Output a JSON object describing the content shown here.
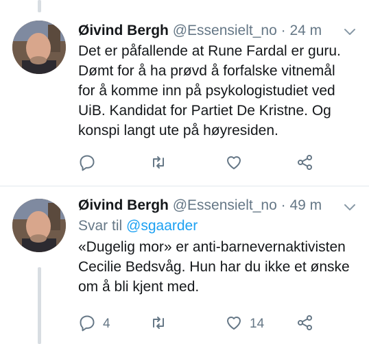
{
  "tweets": [
    {
      "author_name": "Øivind Bergh",
      "handle": "@Essensielt_no",
      "separator": "·",
      "time": "24 m",
      "reply_prefix": "",
      "reply_handle": "",
      "text": "Det er påfallende at Rune Fardal er guru.\nDømt for å ha prøvd å forfalske vitnemål\nfor å komme inn på psykologistudiet ved\nUiB. Kandidat for Partiet De Kristne. Og\nkonspi langt ute på høyresiden.",
      "reply_count": "",
      "retweet_count": "",
      "like_count": ""
    },
    {
      "author_name": "Øivind Bergh",
      "handle": "@Essensielt_no",
      "separator": "·",
      "time": "49 m",
      "reply_prefix": "Svar til",
      "reply_handle": "@sgaarder",
      "text": "«Dugelig mor» er anti-barnevernaktivisten\nCecilie Bedsvåg. Hun har du ikke et ønske\nom å bli kjent med.",
      "reply_count": "4",
      "retweet_count": "",
      "like_count": "14"
    }
  ],
  "colors": {
    "text": "#14171a",
    "secondary": "#657786",
    "link": "#1da1f2",
    "divider": "#e1e8ed",
    "thread_line": "#d8dde2"
  },
  "icons": [
    "reply-icon",
    "retweet-icon",
    "like-icon",
    "share-icon",
    "chevron-down-icon"
  ]
}
